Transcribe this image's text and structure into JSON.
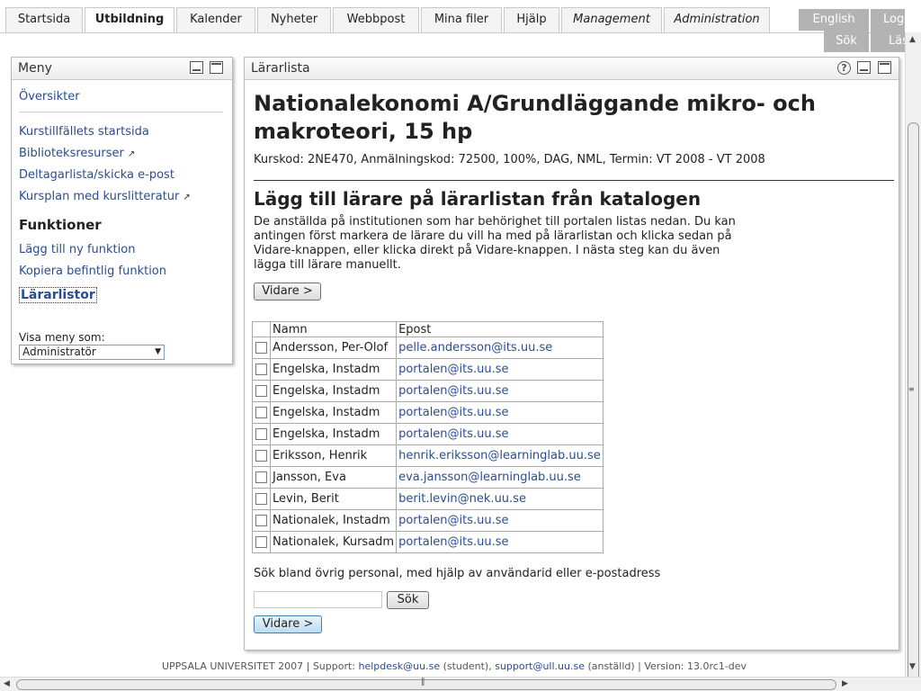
{
  "tabs": {
    "startsida": "Startsida",
    "utbildning": "Utbildning",
    "kalender": "Kalender",
    "nyheter": "Nyheter",
    "webbpost": "Webbpost",
    "mina_filer": "Mina filer",
    "hjalp": "Hjälp",
    "management": "Management",
    "administration": "Administration"
  },
  "utility": {
    "english": "English",
    "log": "Log",
    "sok": "Sök",
    "las": "Läs"
  },
  "menu": {
    "title": "Meny",
    "oversikter": "Översikter",
    "links": {
      "startsida": "Kurstillfällets startsida",
      "bibliotek": "Biblioteksresurser",
      "deltagare": "Deltagarlista/skicka e-post",
      "kursplan": "Kursplan med kurslitteratur"
    },
    "funktioner_heading": "Funktioner",
    "funktioner": {
      "lagg_till": "Lägg till ny funktion",
      "kopiera": "Kopiera befintlig funktion",
      "lararlistor": "Lärarlistor"
    },
    "view_label": "Visa meny som:",
    "view_value": "Administratör"
  },
  "main": {
    "panel_title": "Lärarlista",
    "course_title": "Nationalekonomi A/Grundläggande mikro- och makroteori, 15 hp",
    "course_meta": "Kurskod: 2NE470, Anmälningskod: 72500, 100%, DAG, NML, Termin: VT 2008 - VT 2008",
    "section_title": "Lägg till lärare på lärarlistan från katalogen",
    "intro": "De anställda på institutionen som har behörighet till portalen listas nedan. Du kan antingen först markera de lärare du vill ha med på lärarlistan och klicka sedan på Vidare-knappen, eller klicka direkt på Vidare-knappen. I nästa steg kan du även lägga till lärare manuellt.",
    "vidare": "Vidare >",
    "table_headers": {
      "namn": "Namn",
      "epost": "Epost"
    },
    "teachers": [
      {
        "name": "Andersson, Per-Olof",
        "email": "pelle.andersson@its.uu.se"
      },
      {
        "name": "Engelska, Instadm",
        "email": "portalen@its.uu.se"
      },
      {
        "name": "Engelska, Instadm",
        "email": "portalen@its.uu.se"
      },
      {
        "name": "Engelska, Instadm",
        "email": "portalen@its.uu.se"
      },
      {
        "name": "Engelska, Instadm",
        "email": "portalen@its.uu.se"
      },
      {
        "name": "Eriksson, Henrik",
        "email": "henrik.eriksson@learninglab.uu.se"
      },
      {
        "name": "Jansson, Eva",
        "email": "eva.jansson@learninglab.uu.se"
      },
      {
        "name": "Levin, Berit",
        "email": "berit.levin@nek.uu.se"
      },
      {
        "name": "Nationalek, Instadm",
        "email": "portalen@its.uu.se"
      },
      {
        "name": "Nationalek, Kursadm",
        "email": "portalen@its.uu.se"
      }
    ],
    "search_label": "Sök bland övrig personal, med hjälp av användarid eller e-postadress",
    "search_value": "",
    "search_button": "Sök"
  },
  "footer": {
    "org": "UPPSALA UNIVERSITET 2007 | Support: ",
    "helpdesk": "helpdesk@uu.se",
    "student": " (student), ",
    "support": "support@ull.uu.se",
    "rest": " (anställd) | Version: 13.0rc1-dev"
  },
  "colors": {
    "link": "#2a4d8f",
    "utility_bg": "#b3b3b3",
    "border": "#b8b8b8"
  }
}
